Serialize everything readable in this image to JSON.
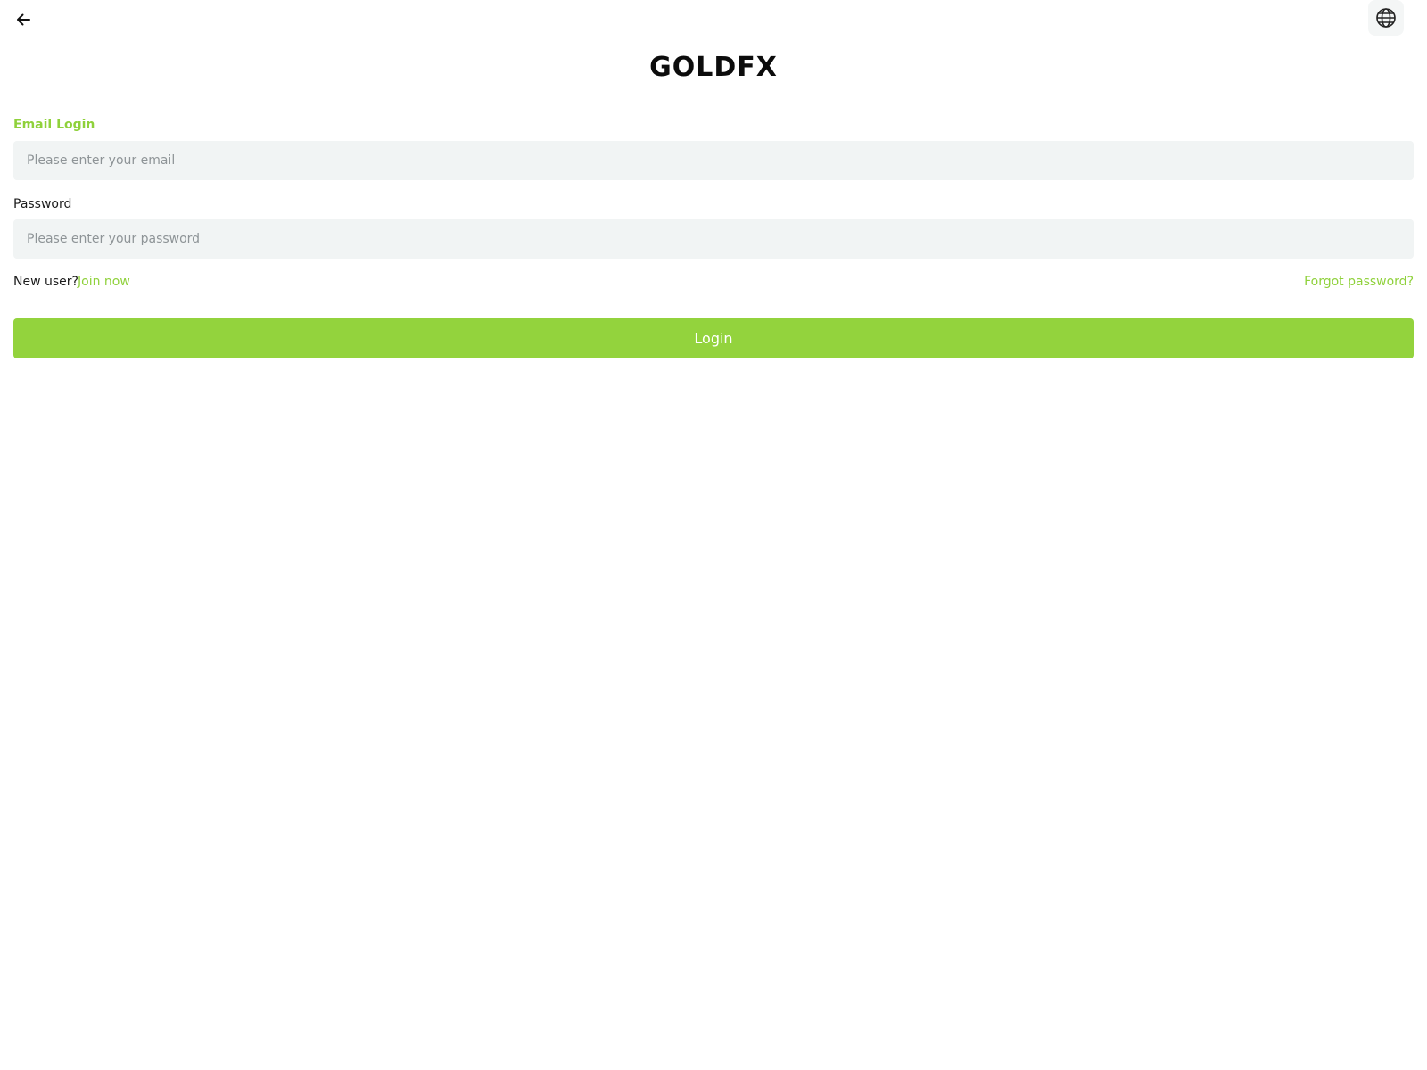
{
  "header": {
    "back_icon": "arrow-left-icon",
    "language_icon": "globe-icon",
    "brand": "GOLDFX"
  },
  "form": {
    "tab_label": "Email Login",
    "email": {
      "value": "",
      "placeholder": "Please enter your email"
    },
    "password": {
      "label": "Password",
      "value": "",
      "placeholder": "Please enter your password"
    },
    "new_user_text": "New user?",
    "join_now": "Join now",
    "forgot_password": "Forgot password?",
    "login_button": "Login"
  },
  "colors": {
    "accent": "#93d33d",
    "input_bg": "#f1f4f4",
    "text": "#1c1c1c",
    "placeholder": "#8e9497"
  }
}
